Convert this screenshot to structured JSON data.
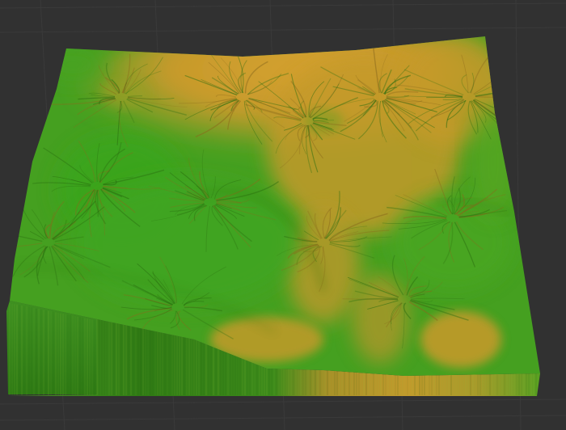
{
  "viewport": {
    "background_color": "#313131",
    "grid_color": "#3a3a3a"
  },
  "terrain": {
    "colors": {
      "low": "#3aa51e",
      "mid": "#6ca82a",
      "high": "#c79a2c",
      "peak": "#d4a12e",
      "side_dark": "#2e7a14",
      "side_light": "#7fb12a",
      "side_gold": "#b79628",
      "ridge_shadow": "#2a6e10",
      "gully_gold": "#8a6a1c"
    }
  }
}
